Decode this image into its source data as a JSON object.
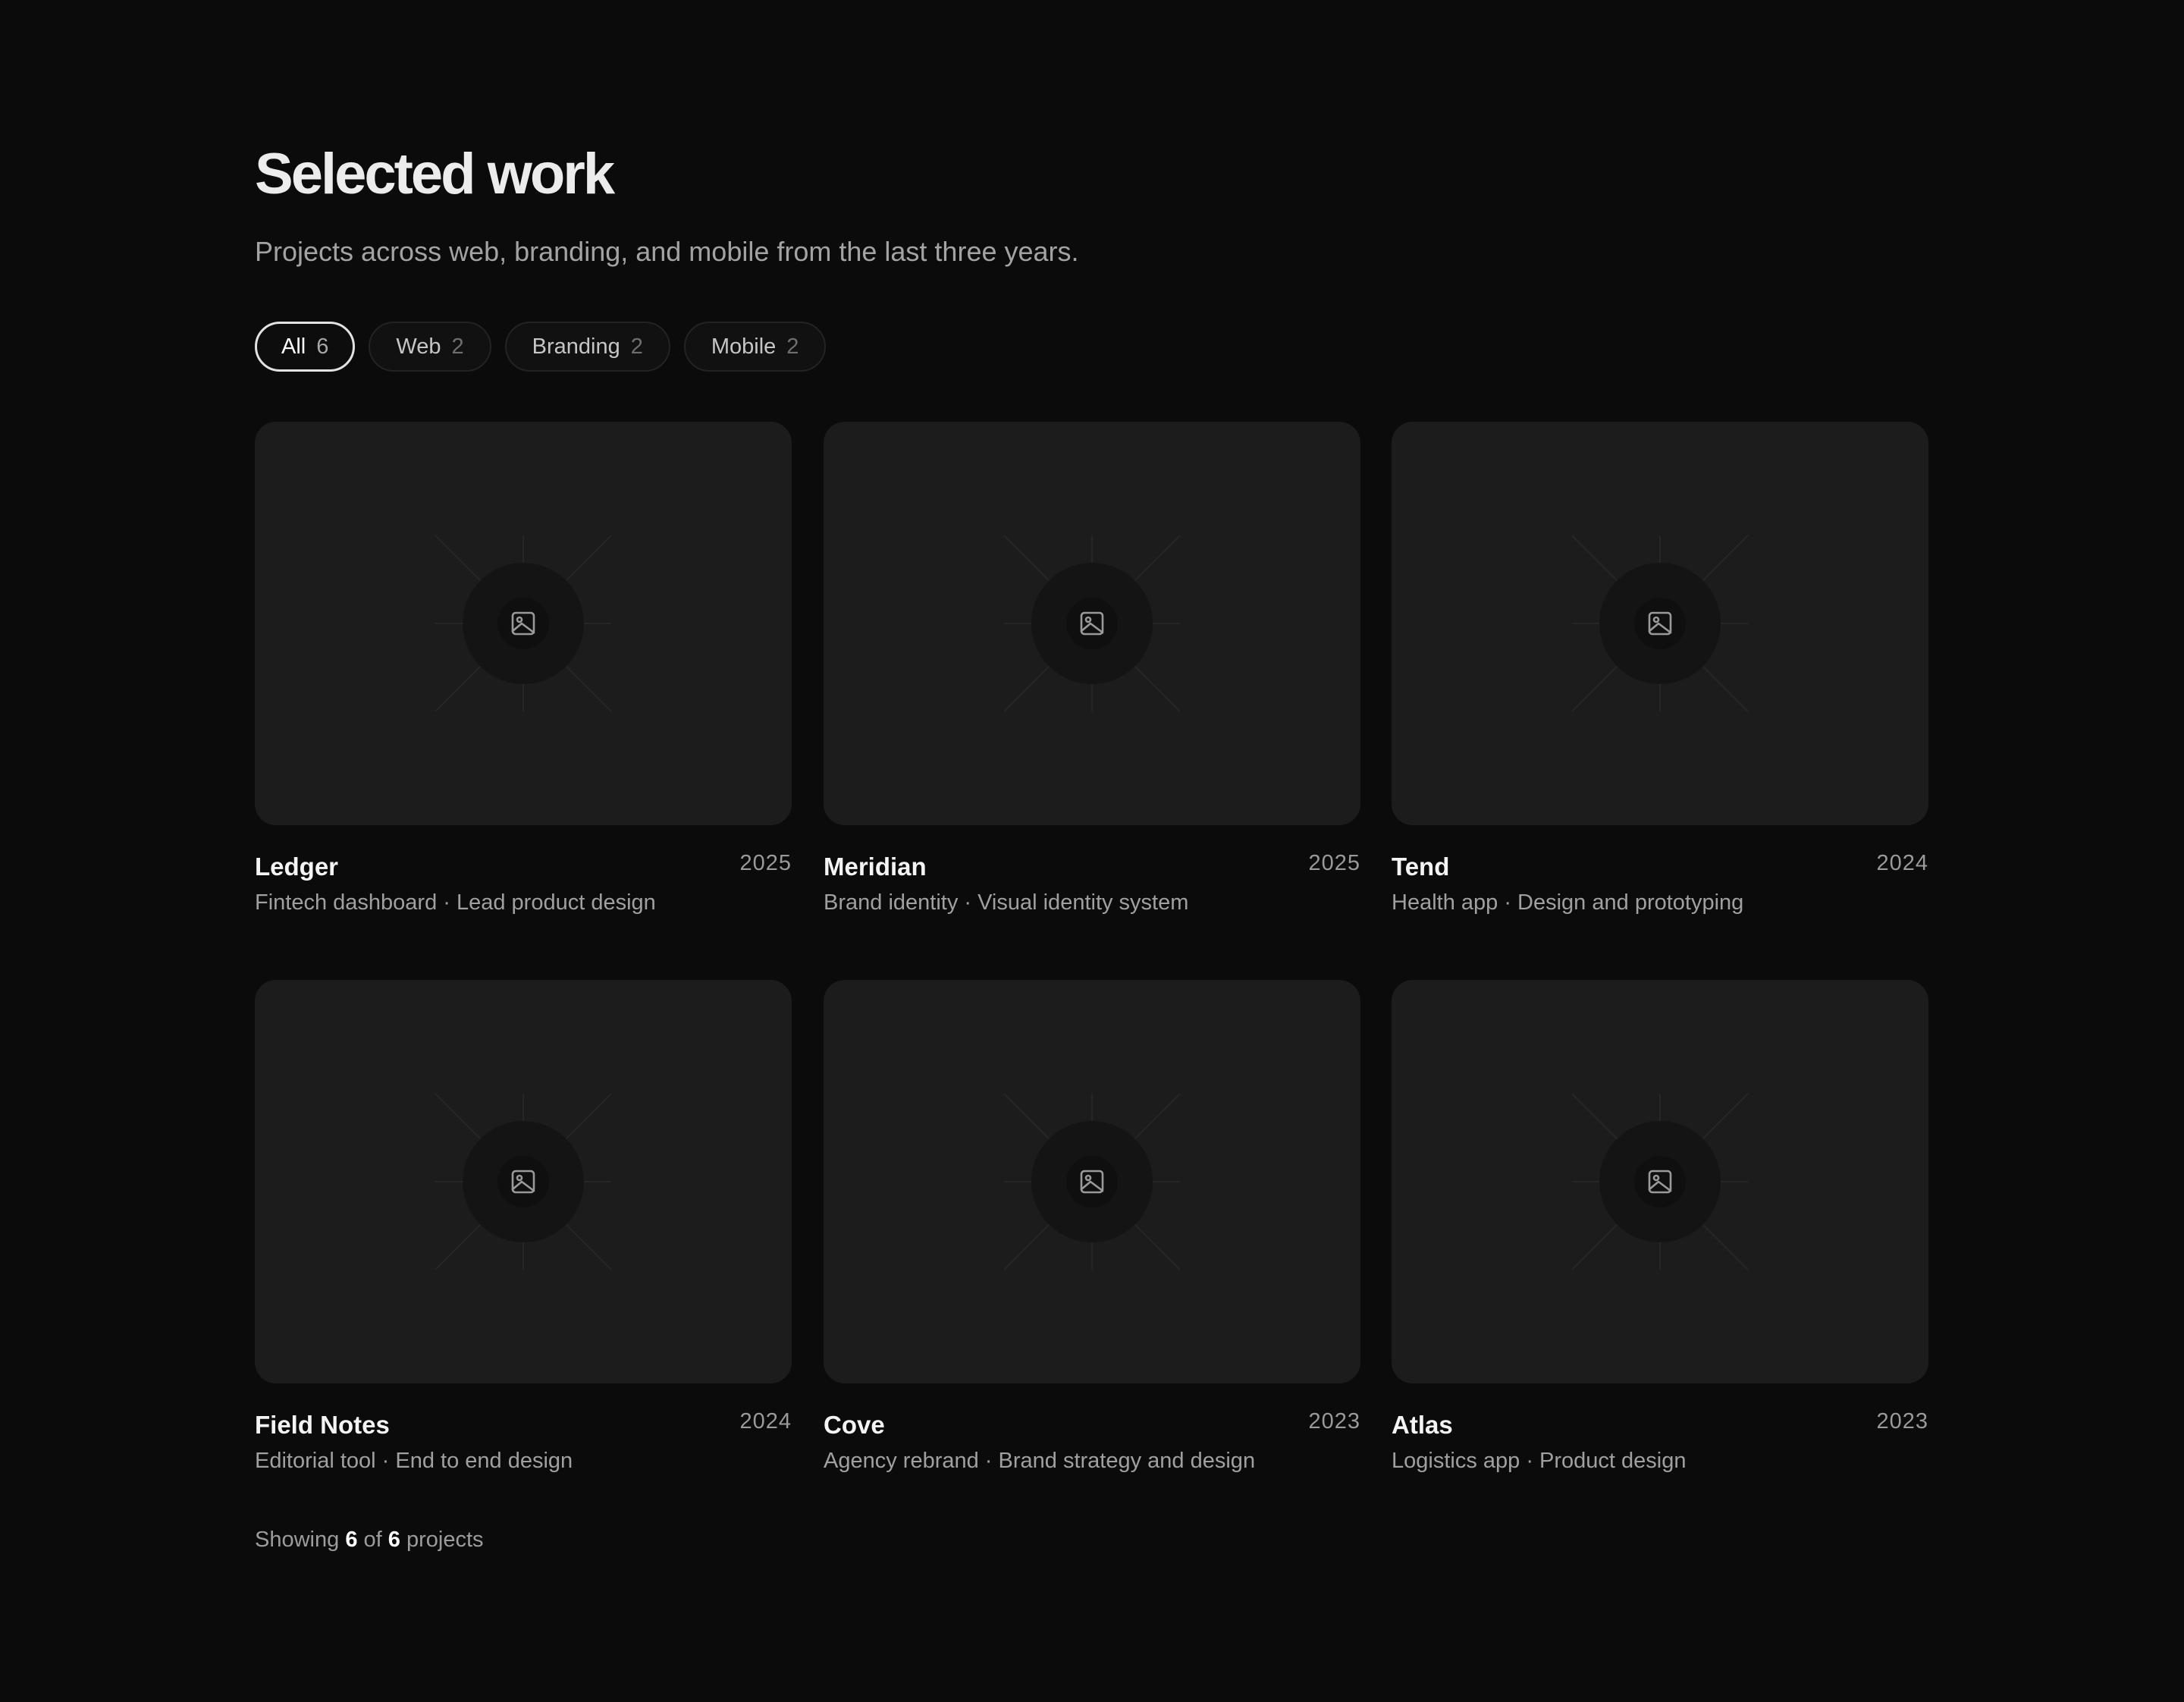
{
  "header": {
    "title": "Selected work",
    "subtitle": "Projects across web, branding, and mobile from the last three years."
  },
  "filters": [
    {
      "label": "All",
      "count": "6",
      "active": true
    },
    {
      "label": "Web",
      "count": "2",
      "active": false
    },
    {
      "label": "Branding",
      "count": "2",
      "active": false
    },
    {
      "label": "Mobile",
      "count": "2",
      "active": false
    }
  ],
  "projects": [
    {
      "title": "Ledger",
      "year": "2025",
      "description": "Fintech dashboard · Lead product design",
      "thumbnail_icon": "image-placeholder-icon"
    },
    {
      "title": "Meridian",
      "year": "2025",
      "description": "Brand identity · Visual identity system",
      "thumbnail_icon": "image-placeholder-icon"
    },
    {
      "title": "Tend",
      "year": "2024",
      "description": "Health app · Design and prototyping",
      "thumbnail_icon": "image-placeholder-icon"
    },
    {
      "title": "Field Notes",
      "year": "2024",
      "description": "Editorial tool · End to end design",
      "thumbnail_icon": "image-placeholder-icon"
    },
    {
      "title": "Cove",
      "year": "2023",
      "description": "Agency rebrand · Brand strategy and design",
      "thumbnail_icon": "image-placeholder-icon"
    },
    {
      "title": "Atlas",
      "year": "2023",
      "description": "Logistics app · Product design",
      "thumbnail_icon": "image-placeholder-icon"
    }
  ],
  "footer": {
    "prefix": "Showing",
    "shown": "6",
    "middle": "of",
    "total": "6",
    "suffix": "projects"
  },
  "colors": {
    "background": "#0b0b0b",
    "card": "#1c1c1c",
    "text_primary": "#f4f4f4",
    "text_secondary": "#a0a0a0",
    "active_chip_border": "#e2e2e2"
  }
}
